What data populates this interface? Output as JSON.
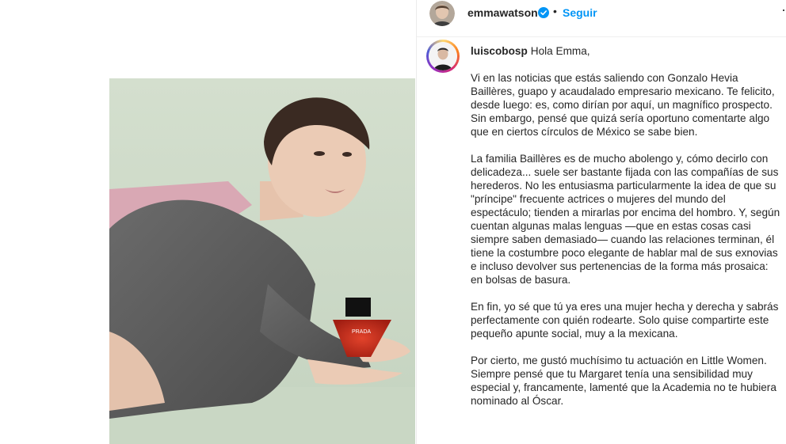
{
  "post": {
    "author": "emmawatson",
    "follow_label": "Seguir",
    "separator": "•",
    "more_icon": "more-horizontal-icon"
  },
  "caption": {
    "username": "luiscobosp",
    "greeting": "Hola Emma,",
    "paragraphs": [
      "Vi en las noticias que estás saliendo con Gonzalo Hevia Baillères, guapo y acaudalado empresario mexicano. Te felicito, desde luego: es, como dirían por aquí, un magnífico prospecto. Sin embargo, pensé que quizá sería oportuno comentarte algo que en ciertos círculos de México se sabe bien.",
      "La familia Baillères es de mucho abolengo y, cómo decirlo con delicadeza... suele ser bastante fijada con las compañías de sus herederos. No les entusiasma particularmente la idea de que su \"príncipe\" frecuente actrices o mujeres del mundo del espectáculo; tienden a mirarlas por encima del hombro. Y, según cuentan algunas malas lenguas —que en estas cosas casi siempre saben demasiado— cuando las relaciones terminan, él tiene la costumbre poco elegante de hablar mal de sus exnovias e incluso devolver sus pertenencias de la forma más prosaica: en bolsas de basura.",
      "En fin, yo sé que tú ya eres una mujer hecha y derecha y sabrás perfectamente con quién rodearte. Solo quise compartirte este pequeño apunte social, muy a la mexicana.",
      "Por cierto, me gustó muchísimo tu actuación en Little Women. Siempre pensé que tu Margaret tenía una sensibilidad muy especial y, francamente, lamenté que la Academia no te hubiera nominado al Óscar."
    ]
  },
  "photo": {
    "bottle_label": "PRADA"
  },
  "colors": {
    "accent_blue": "#0095f6",
    "verified_blue": "#0095f6",
    "background_green": "#cfdccb"
  }
}
